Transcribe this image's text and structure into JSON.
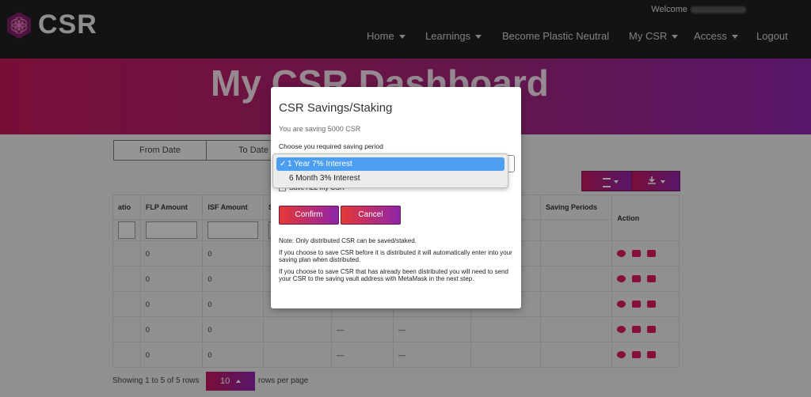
{
  "brand": {
    "name": "CSR"
  },
  "header": {
    "welcome": "Welcome"
  },
  "nav": [
    {
      "label": "Home",
      "dropdown": true
    },
    {
      "label": "Learnings",
      "dropdown": true
    },
    {
      "label": "Become Plastic Neutral",
      "dropdown": false
    },
    {
      "label": "My CSR",
      "dropdown": true
    },
    {
      "label": "Access",
      "dropdown": true
    },
    {
      "label": "Logout",
      "dropdown": false
    }
  ],
  "hero": {
    "title": "My CSR Dashboard"
  },
  "filters": {
    "from_date": "From Date",
    "to_date": "To Date"
  },
  "table": {
    "headers": [
      "atio",
      "FLP Amount",
      "ISF Amount",
      "S",
      "",
      "",
      "st",
      "Saving Periods",
      "Action"
    ],
    "rows": [
      [
        "",
        "0",
        "0",
        "",
        "",
        "",
        "",
        "",
        ""
      ],
      [
        "",
        "0",
        "0",
        "",
        "",
        "",
        "",
        "",
        ""
      ],
      [
        "",
        "0",
        "0",
        "",
        "",
        "",
        "",
        "",
        ""
      ],
      [
        "",
        "0",
        "0",
        "",
        "—",
        "—",
        "",
        "",
        ""
      ],
      [
        "",
        "0",
        "0",
        "",
        "—",
        "—",
        "",
        "",
        ""
      ]
    ]
  },
  "footer": {
    "showing": "Showing 1 to 5 of 5 rows",
    "page_size": "10",
    "rows_per_page": "rows per page"
  },
  "modal": {
    "title": "CSR Savings/Staking",
    "subtitle": "You are saving 5000 CSR",
    "choose_label": "Choose you required saving period",
    "options": [
      {
        "label": "1 Year 7% Interest",
        "selected": true
      },
      {
        "label": "6 Month 3% Interest",
        "selected": false
      }
    ],
    "checkbox_label": "Save ALL my CSR",
    "confirm": "Confirm",
    "cancel": "Cancel",
    "notes": [
      "Note: Only distributed CSR can be saved/staked.",
      "If you choose to save CSR before it is distributed it will automatically enter into your saving plan when distributed.",
      "If you choose to save CSR that has already been distributed you will need to send your CSR to the saving vault address with MetaMask in the next step."
    ]
  },
  "colors": {
    "accent_start": "#c2185b",
    "accent_end": "#8e24aa",
    "navbar": "#1f1f1f",
    "selected_option": "#4b9ef0"
  }
}
